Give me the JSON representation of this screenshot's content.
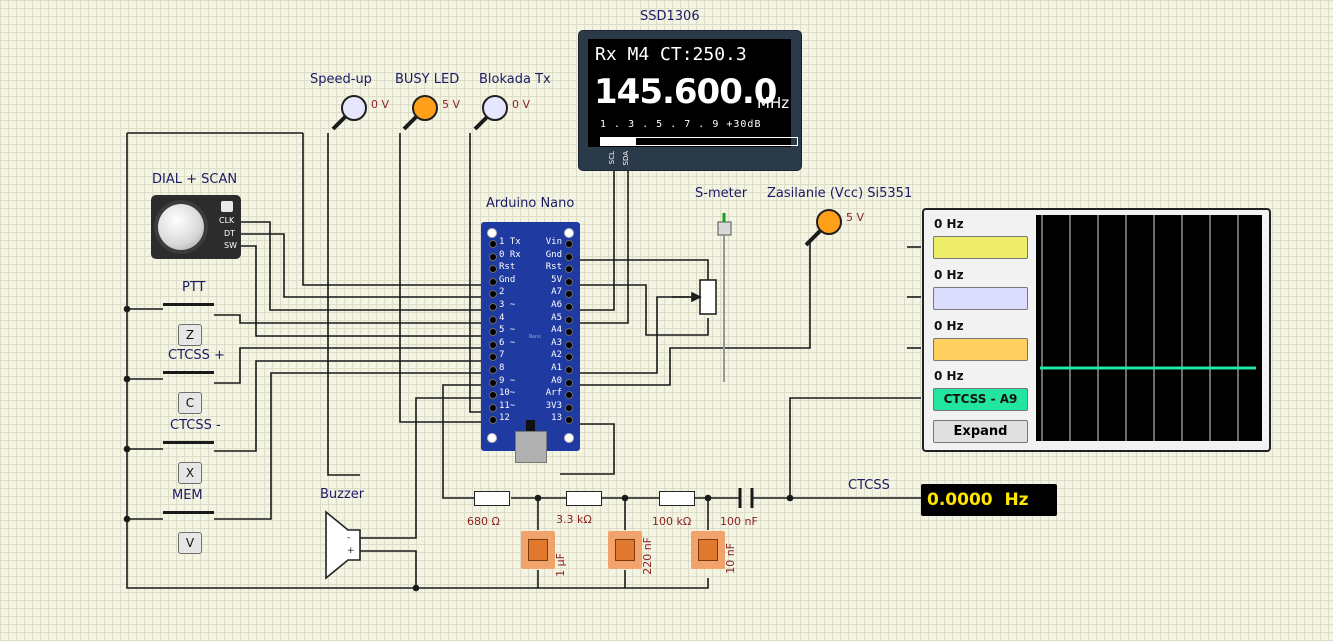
{
  "oled": {
    "title": "SSD1306",
    "line1": "Rx M4  CT:250.3",
    "freq": "145.600.0",
    "unit": "MHz",
    "scale": "1 . 3 . 5 . 7 . 9 +30dB",
    "signal_bar": 0.18,
    "pin_scl": "SCL",
    "pin_sda": "SDA"
  },
  "probes": {
    "speedup": {
      "label": "Speed-up",
      "voltage": "0 V",
      "color": "#e6e6ff"
    },
    "busy": {
      "label": "BUSY LED",
      "voltage": "5 V",
      "color": "#ff9f1a"
    },
    "blokada": {
      "label": "Blokada Tx",
      "voltage": "0 V",
      "color": "#e6e6ff"
    },
    "zasilanie": {
      "label": "Zasilanie (Vcc) Si5351",
      "voltage": "5 V",
      "color": "#ff9f1a"
    }
  },
  "arduino": {
    "label": "Arduino Nano",
    "left_pins": [
      "1 Tx",
      "0 Rx",
      "Rst",
      "Gnd",
      "2",
      "3 ~",
      "4",
      "5 ~",
      "6 ~",
      "7",
      "8",
      "9 ~",
      "10~",
      "11~",
      "12"
    ],
    "right_pins": [
      "Vin",
      "Gnd",
      "Rst",
      "5V",
      "A7",
      "A6",
      "A5",
      "A4",
      "A3",
      "A2",
      "A1",
      "A0",
      "Arf",
      "3V3",
      "13"
    ],
    "chip_text": "Nano"
  },
  "encoder": {
    "label": "DIAL + SCAN",
    "clk": "CLK",
    "dt": "DT",
    "sw": "SW"
  },
  "buttons": [
    {
      "label": "PTT",
      "key": "Z"
    },
    {
      "label": "CTCSS +",
      "key": "C"
    },
    {
      "label": "CTCSS -",
      "key": "X"
    },
    {
      "label": "MEM",
      "key": "V"
    }
  ],
  "buzzer": {
    "label": "Buzzer",
    "minus": "-",
    "plus": "+"
  },
  "smeter": {
    "label": "S-meter"
  },
  "scope": {
    "channels": [
      {
        "freq": "0 Hz",
        "color": "#eded6a"
      },
      {
        "freq": "0 Hz",
        "color": "#dcdcff"
      },
      {
        "freq": "0 Hz",
        "color": "#ffd060"
      },
      {
        "freq": "0 Hz",
        "name": "CTCSS - A9",
        "color": "#22e6a0"
      }
    ],
    "expand_label": "Expand"
  },
  "filter": {
    "resistors": [
      "680 Ω",
      "3.3 kΩ",
      "100 kΩ"
    ],
    "capacitors": [
      "1 µF",
      "220 nF",
      "10 nF"
    ],
    "coupling_cap": "100 nF"
  },
  "ctcss_meter": {
    "label": "CTCSS",
    "value": "0.0000",
    "unit": "Hz"
  }
}
